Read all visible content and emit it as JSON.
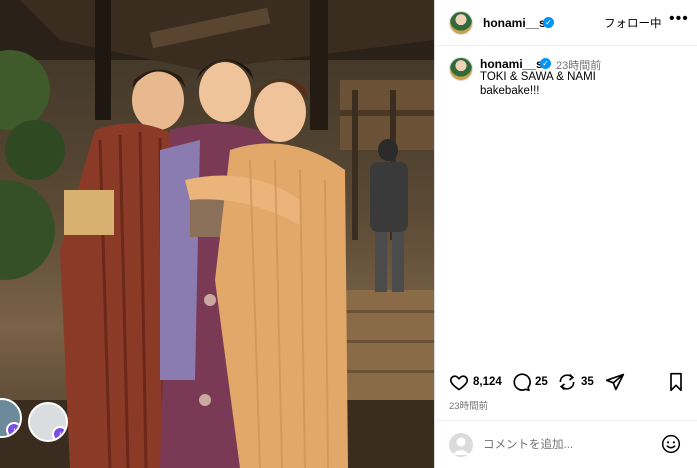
{
  "post": {
    "username": "honami__s",
    "follow_label": "フォロー中",
    "more_icon": "more-horizontal-icon",
    "verified_icon": "verified-badge-icon"
  },
  "caption": {
    "username": "honami__s",
    "time": "23時間前",
    "line1": "TOKI & SAWA & NAMI",
    "line2": "bakebake!!!"
  },
  "actions": {
    "like_icon": "heart-icon",
    "like_count": "8,124",
    "comment_icon": "comment-bubble-icon",
    "comment_count": "25",
    "repost_icon": "repost-icon",
    "repost_count": "35",
    "share_icon": "send-icon",
    "save_icon": "bookmark-icon"
  },
  "timestamp": "23時間前",
  "comment_box": {
    "placeholder": "コメントを追加...",
    "emoji_icon": "smiley-icon"
  },
  "colors": {
    "verified_blue": "#0095f6",
    "secondary_text": "#737373",
    "border": "#dbdbdb"
  }
}
